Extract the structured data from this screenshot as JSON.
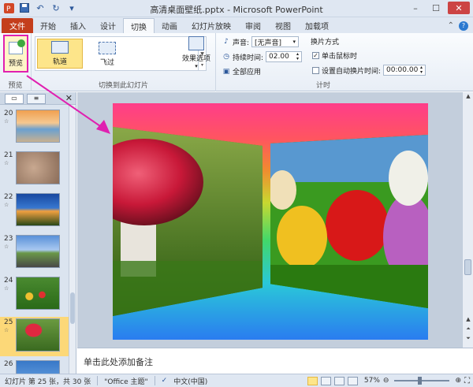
{
  "window": {
    "title": "高清桌面壁纸.pptx - Microsoft PowerPoint",
    "minimize": "–",
    "maximize": "☐",
    "close": "✕"
  },
  "tabs": [
    "文件",
    "开始",
    "插入",
    "设计",
    "切换",
    "动画",
    "幻灯片放映",
    "审阅",
    "视图",
    "加载项"
  ],
  "active_tab": "切换",
  "ribbon": {
    "preview": {
      "label": "预览",
      "group": "预览"
    },
    "transitions": {
      "group": "切换到此幻灯片",
      "items": [
        {
          "label": "轨道",
          "selected": true
        },
        {
          "label": "飞过",
          "selected": false
        }
      ],
      "effect_options": "效果选项"
    },
    "timing": {
      "group": "计时",
      "sound_label": "声音:",
      "sound_value": "[无声音]",
      "duration_label": "持续时间:",
      "duration_value": "02.00",
      "apply_all": "全部应用",
      "advance_title": "换片方式",
      "on_click": "单击鼠标时",
      "on_click_checked": true,
      "after_label": "设置自动换片时间:",
      "after_value": "00:00.00",
      "after_checked": false
    }
  },
  "pane": {
    "slides": [
      {
        "num": "20",
        "star": "☆"
      },
      {
        "num": "21",
        "star": "☆"
      },
      {
        "num": "22",
        "star": "☆"
      },
      {
        "num": "23",
        "star": "☆"
      },
      {
        "num": "24",
        "star": "☆"
      },
      {
        "num": "25",
        "star": "☆",
        "selected": true
      },
      {
        "num": "26",
        "star": "☆"
      }
    ]
  },
  "notes_placeholder": "单击此处添加备注",
  "status": {
    "slide_info": "幻灯片 第 25 张，共 30 张",
    "theme": "\"Office 主题\"",
    "language": "中文(中国)",
    "zoom": "57%"
  },
  "colors": {
    "file_tab": "#c43e1c",
    "highlight": "#e020b0",
    "selected": "#fde58a"
  }
}
